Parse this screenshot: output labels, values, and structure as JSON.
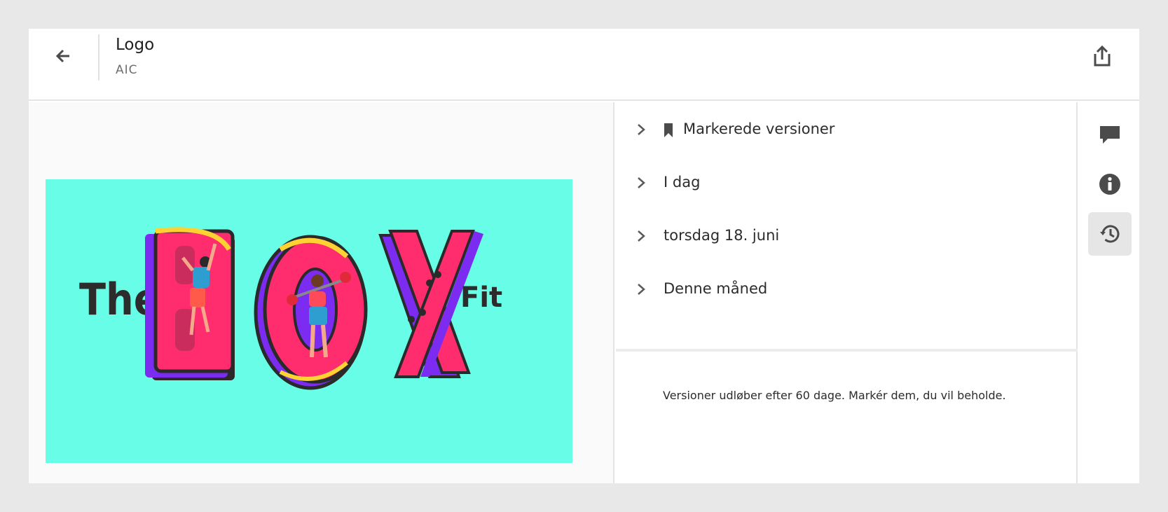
{
  "header": {
    "title": "Logo",
    "subtitle": "AIC",
    "back_icon": "arrow-left-icon",
    "share_icon": "share-icon"
  },
  "preview": {
    "logo_words": [
      "The",
      "BOX",
      "Fit"
    ],
    "background_color": "#68fde6"
  },
  "versions": {
    "groups": [
      {
        "label": "Markerede versioner",
        "icon": "bookmark-icon"
      },
      {
        "label": "I dag"
      },
      {
        "label": "torsdag 18. juni"
      },
      {
        "label": "Denne måned"
      }
    ],
    "notice": "Versioner udløber efter 60 dage. Markér dem, du vil beholde."
  },
  "rail": {
    "items": [
      {
        "icon": "comment-icon"
      },
      {
        "icon": "info-icon"
      },
      {
        "icon": "history-icon",
        "active": true
      }
    ]
  },
  "colors": {
    "accent": "#ff2d6e",
    "logo_purple": "#7b2cf0",
    "logo_yellow": "#ffd233"
  }
}
